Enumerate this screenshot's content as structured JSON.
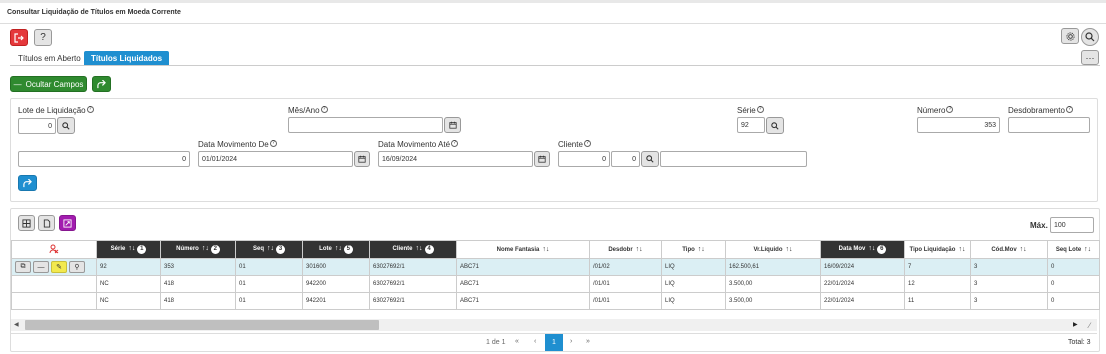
{
  "page": {
    "title": "Consultar Liquidação de Títulos em Moeda Corrente"
  },
  "toolbar": {
    "help_label": "?"
  },
  "tabs": [
    {
      "label": "Títulos em Aberto",
      "active": false
    },
    {
      "label": "Títulos Liquidados",
      "active": true
    }
  ],
  "actions": {
    "hide_fields_label": "Ocultar Campos"
  },
  "filters": {
    "lote": {
      "label": "Lote de Liquidação",
      "value": "0"
    },
    "mes_ano": {
      "label": "Mês/Ano",
      "value": ""
    },
    "serie": {
      "label": "Série",
      "value": "92"
    },
    "numero": {
      "label": "Número",
      "value": "353"
    },
    "desdobramento": {
      "label": "Desdobramento",
      "value": ""
    },
    "extra": {
      "value": "0"
    },
    "data_de": {
      "label": "Data Movimento De",
      "value": "01/01/2024"
    },
    "data_ate": {
      "label": "Data Movimento Até",
      "value": "16/09/2024"
    },
    "cliente": {
      "label": "Cliente",
      "value1": "0",
      "value2": "0",
      "name": ""
    }
  },
  "grid": {
    "max_label": "Máx.",
    "max_value": "100",
    "columns": [
      {
        "label": "Série",
        "badge": "1",
        "dark": true
      },
      {
        "label": "Número",
        "badge": "2",
        "dark": true
      },
      {
        "label": "Seq",
        "badge": "3",
        "dark": true
      },
      {
        "label": "Lote",
        "badge": "5",
        "dark": true
      },
      {
        "label": "Cliente",
        "badge": "4",
        "dark": true
      },
      {
        "label": "Nome Fantasia",
        "badge": "",
        "dark": false
      },
      {
        "label": "Desdobr",
        "badge": "",
        "dark": false
      },
      {
        "label": "Tipo",
        "badge": "",
        "dark": false
      },
      {
        "label": "Vr.Líquido",
        "badge": "",
        "dark": false
      },
      {
        "label": "Data Mov",
        "badge": "6",
        "dark": true
      },
      {
        "label": "Tipo Liquidação",
        "badge": "",
        "dark": false
      },
      {
        "label": "Cód.Mov",
        "badge": "",
        "dark": false
      },
      {
        "label": "Seq Lote",
        "badge": "",
        "dark": false
      }
    ],
    "rows": [
      [
        "92",
        "353",
        "01",
        "301600",
        "63027692/1",
        "ABC71",
        "/01/02",
        "LIQ",
        "162.500,61",
        "16/09/2024",
        "7",
        "3",
        "0"
      ],
      [
        "NC",
        "418",
        "01",
        "942200",
        "63027692/1",
        "ABC71",
        "/01/01",
        "LIQ",
        "3.500,00",
        "22/01/2024",
        "12",
        "3",
        "0"
      ],
      [
        "NC",
        "418",
        "01",
        "942201",
        "63027692/1",
        "ABC71",
        "/01/01",
        "LIQ",
        "3.500,00",
        "22/01/2024",
        "11",
        "3",
        "0"
      ]
    ],
    "pagination": {
      "page_info": "1 de 1",
      "current_page": "1",
      "total_label": "Total: 3"
    }
  }
}
